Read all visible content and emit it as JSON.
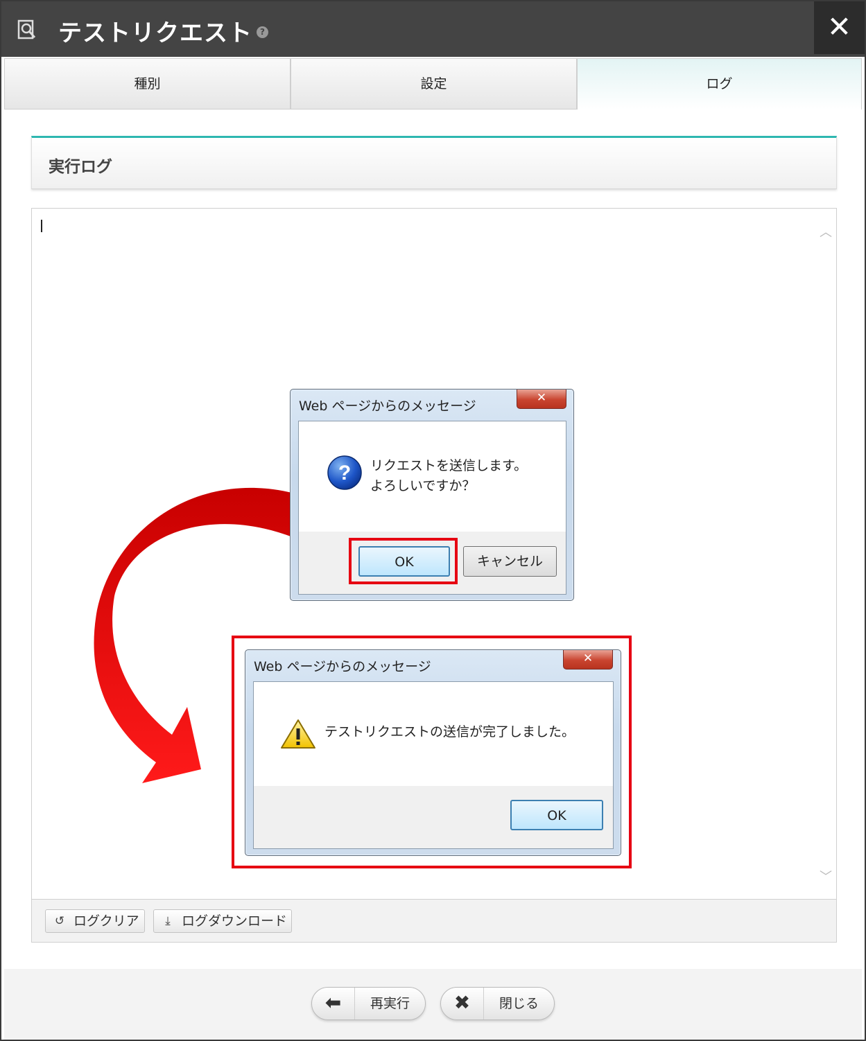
{
  "window": {
    "title": "テストリクエスト",
    "help_icon": "question-circle-icon",
    "close_icon": "close-icon",
    "close_glyph": "✕"
  },
  "tabs": [
    {
      "label": "種別",
      "active": false
    },
    {
      "label": "設定",
      "active": false
    },
    {
      "label": "ログ",
      "active": true
    }
  ],
  "section": {
    "title": "実行ログ"
  },
  "log_toolbar": {
    "clear_label": "ログクリア",
    "download_label": "ログダウンロード"
  },
  "footer": {
    "rerun_label": "再実行",
    "close_label": "閉じる"
  },
  "dialog_confirm": {
    "title": "Web ページからのメッセージ",
    "message": "リクエストを送信します。\nよろしいですか？",
    "ok_label": "OK",
    "cancel_label": "キャンセル",
    "icon": "question-icon"
  },
  "dialog_done": {
    "title": "Web ページからのメッセージ",
    "message": "テストリクエストの送信が完了しました。",
    "ok_label": "OK",
    "icon": "warning-icon"
  },
  "colors": {
    "titlebar": "#444444",
    "accent_teal": "#2eb7b0",
    "highlight_red": "#e60012",
    "arrow_red": "#e00000"
  }
}
